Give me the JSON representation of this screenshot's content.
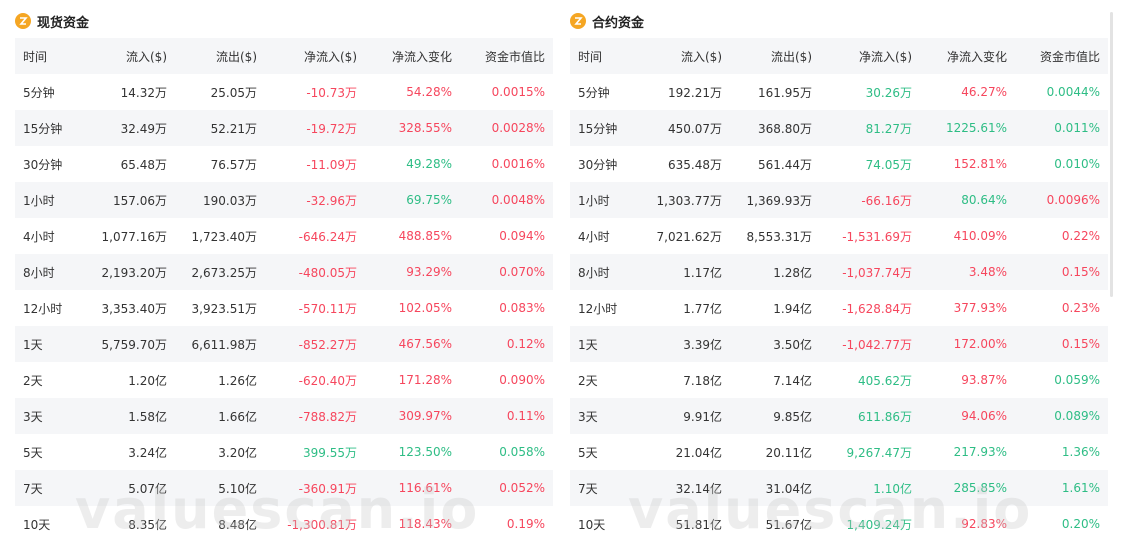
{
  "spot": {
    "title": "现货资金",
    "headers": [
      "时间",
      "流入($)",
      "流出($)",
      "净流入($)",
      "净流入变化",
      "资金市值比"
    ],
    "rows": [
      {
        "time": "5分钟",
        "inflow": "14.32万",
        "outflow": "25.05万",
        "net": "-10.73万",
        "net_dir": "red",
        "change": "54.28%",
        "change_dir": "red",
        "ratio": "0.0015%",
        "ratio_dir": "red"
      },
      {
        "time": "15分钟",
        "inflow": "32.49万",
        "outflow": "52.21万",
        "net": "-19.72万",
        "net_dir": "red",
        "change": "328.55%",
        "change_dir": "red",
        "ratio": "0.0028%",
        "ratio_dir": "red"
      },
      {
        "time": "30分钟",
        "inflow": "65.48万",
        "outflow": "76.57万",
        "net": "-11.09万",
        "net_dir": "red",
        "change": "49.28%",
        "change_dir": "green",
        "ratio": "0.0016%",
        "ratio_dir": "red"
      },
      {
        "time": "1小时",
        "inflow": "157.06万",
        "outflow": "190.03万",
        "net": "-32.96万",
        "net_dir": "red",
        "change": "69.75%",
        "change_dir": "green",
        "ratio": "0.0048%",
        "ratio_dir": "red"
      },
      {
        "time": "4小时",
        "inflow": "1,077.16万",
        "outflow": "1,723.40万",
        "net": "-646.24万",
        "net_dir": "red",
        "change": "488.85%",
        "change_dir": "red",
        "ratio": "0.094%",
        "ratio_dir": "red"
      },
      {
        "time": "8小时",
        "inflow": "2,193.20万",
        "outflow": "2,673.25万",
        "net": "-480.05万",
        "net_dir": "red",
        "change": "93.29%",
        "change_dir": "red",
        "ratio": "0.070%",
        "ratio_dir": "red"
      },
      {
        "time": "12小时",
        "inflow": "3,353.40万",
        "outflow": "3,923.51万",
        "net": "-570.11万",
        "net_dir": "red",
        "change": "102.05%",
        "change_dir": "red",
        "ratio": "0.083%",
        "ratio_dir": "red"
      },
      {
        "time": "1天",
        "inflow": "5,759.70万",
        "outflow": "6,611.98万",
        "net": "-852.27万",
        "net_dir": "red",
        "change": "467.56%",
        "change_dir": "red",
        "ratio": "0.12%",
        "ratio_dir": "red"
      },
      {
        "time": "2天",
        "inflow": "1.20亿",
        "outflow": "1.26亿",
        "net": "-620.40万",
        "net_dir": "red",
        "change": "171.28%",
        "change_dir": "red",
        "ratio": "0.090%",
        "ratio_dir": "red"
      },
      {
        "time": "3天",
        "inflow": "1.58亿",
        "outflow": "1.66亿",
        "net": "-788.82万",
        "net_dir": "red",
        "change": "309.97%",
        "change_dir": "red",
        "ratio": "0.11%",
        "ratio_dir": "red"
      },
      {
        "time": "5天",
        "inflow": "3.24亿",
        "outflow": "3.20亿",
        "net": "399.55万",
        "net_dir": "green",
        "change": "123.50%",
        "change_dir": "green",
        "ratio": "0.058%",
        "ratio_dir": "green"
      },
      {
        "time": "7天",
        "inflow": "5.07亿",
        "outflow": "5.10亿",
        "net": "-360.91万",
        "net_dir": "red",
        "change": "116.61%",
        "change_dir": "red",
        "ratio": "0.052%",
        "ratio_dir": "red"
      },
      {
        "time": "10天",
        "inflow": "8.35亿",
        "outflow": "8.48亿",
        "net": "-1,300.81万",
        "net_dir": "red",
        "change": "118.43%",
        "change_dir": "red",
        "ratio": "0.19%",
        "ratio_dir": "red"
      }
    ]
  },
  "futures": {
    "title": "合约资金",
    "headers": [
      "时间",
      "流入($)",
      "流出($)",
      "净流入($)",
      "净流入变化",
      "资金市值比"
    ],
    "rows": [
      {
        "time": "5分钟",
        "inflow": "192.21万",
        "outflow": "161.95万",
        "net": "30.26万",
        "net_dir": "green",
        "change": "46.27%",
        "change_dir": "red",
        "ratio": "0.0044%",
        "ratio_dir": "green"
      },
      {
        "time": "15分钟",
        "inflow": "450.07万",
        "outflow": "368.80万",
        "net": "81.27万",
        "net_dir": "green",
        "change": "1225.61%",
        "change_dir": "green",
        "ratio": "0.011%",
        "ratio_dir": "green"
      },
      {
        "time": "30分钟",
        "inflow": "635.48万",
        "outflow": "561.44万",
        "net": "74.05万",
        "net_dir": "green",
        "change": "152.81%",
        "change_dir": "red",
        "ratio": "0.010%",
        "ratio_dir": "green"
      },
      {
        "time": "1小时",
        "inflow": "1,303.77万",
        "outflow": "1,369.93万",
        "net": "-66.16万",
        "net_dir": "red",
        "change": "80.64%",
        "change_dir": "green",
        "ratio": "0.0096%",
        "ratio_dir": "red"
      },
      {
        "time": "4小时",
        "inflow": "7,021.62万",
        "outflow": "8,553.31万",
        "net": "-1,531.69万",
        "net_dir": "red",
        "change": "410.09%",
        "change_dir": "red",
        "ratio": "0.22%",
        "ratio_dir": "red"
      },
      {
        "time": "8小时",
        "inflow": "1.17亿",
        "outflow": "1.28亿",
        "net": "-1,037.74万",
        "net_dir": "red",
        "change": "3.48%",
        "change_dir": "red",
        "ratio": "0.15%",
        "ratio_dir": "red"
      },
      {
        "time": "12小时",
        "inflow": "1.77亿",
        "outflow": "1.94亿",
        "net": "-1,628.84万",
        "net_dir": "red",
        "change": "377.93%",
        "change_dir": "red",
        "ratio": "0.23%",
        "ratio_dir": "red"
      },
      {
        "time": "1天",
        "inflow": "3.39亿",
        "outflow": "3.50亿",
        "net": "-1,042.77万",
        "net_dir": "red",
        "change": "172.00%",
        "change_dir": "red",
        "ratio": "0.15%",
        "ratio_dir": "red"
      },
      {
        "time": "2天",
        "inflow": "7.18亿",
        "outflow": "7.14亿",
        "net": "405.62万",
        "net_dir": "green",
        "change": "93.87%",
        "change_dir": "red",
        "ratio": "0.059%",
        "ratio_dir": "green"
      },
      {
        "time": "3天",
        "inflow": "9.91亿",
        "outflow": "9.85亿",
        "net": "611.86万",
        "net_dir": "green",
        "change": "94.06%",
        "change_dir": "red",
        "ratio": "0.089%",
        "ratio_dir": "green"
      },
      {
        "time": "5天",
        "inflow": "21.04亿",
        "outflow": "20.11亿",
        "net": "9,267.47万",
        "net_dir": "green",
        "change": "217.93%",
        "change_dir": "green",
        "ratio": "1.36%",
        "ratio_dir": "green"
      },
      {
        "time": "7天",
        "inflow": "32.14亿",
        "outflow": "31.04亿",
        "net": "1.10亿",
        "net_dir": "green",
        "change": "285.85%",
        "change_dir": "green",
        "ratio": "1.61%",
        "ratio_dir": "green"
      },
      {
        "time": "10天",
        "inflow": "51.81亿",
        "outflow": "51.67亿",
        "net": "1,409.24万",
        "net_dir": "green",
        "change": "92.83%",
        "change_dir": "red",
        "ratio": "0.20%",
        "ratio_dir": "green"
      }
    ]
  },
  "watermark": "valuescan.io",
  "icons": {
    "panel_icon": "coin-icon"
  },
  "colors": {
    "up": "#2ebd85",
    "down": "#f6465d",
    "icon": "#f5a623"
  }
}
